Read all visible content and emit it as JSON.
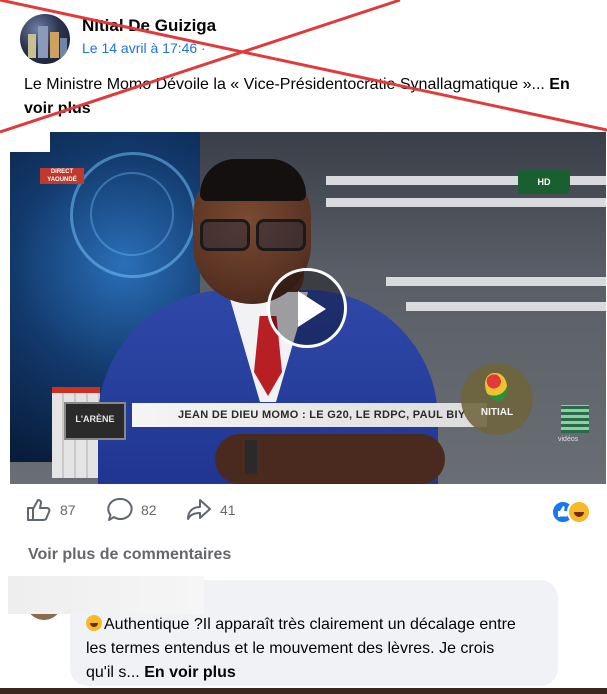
{
  "post": {
    "author": "Nitial De Guiziga",
    "date": "Le 14 avril à 17:46",
    "date_separator": "·",
    "text": "Le Ministre Momo Dévoile la « Vice-Présidentocratie Synallagmatique »...",
    "see_more": "En voir plus"
  },
  "video": {
    "live_badge": "DIRECT YAOUNDÉ",
    "show_name": "L'ARÈNE",
    "lower_third": "JEAN DE DIEU MOMO : LE G20, LE RDPC, PAUL BIY",
    "channel_logo": "HD",
    "watermark": "NITIAL",
    "qr_label": "vidéos"
  },
  "actions": {
    "likes": "87",
    "comments": "82",
    "shares": "41"
  },
  "comments": {
    "view_more": "Voir plus de commentaires",
    "first": {
      "text": "Authentique ?Il apparaît très clairement un décalage entre les termes entendus et le mouvement des lèvres. Je crois qu'il s...",
      "see_more": "En voir plus"
    }
  },
  "colors": {
    "cross": "#e03a3a",
    "link": "#1b74e4",
    "muted": "#65676b",
    "bubble": "#f0f2f5"
  }
}
